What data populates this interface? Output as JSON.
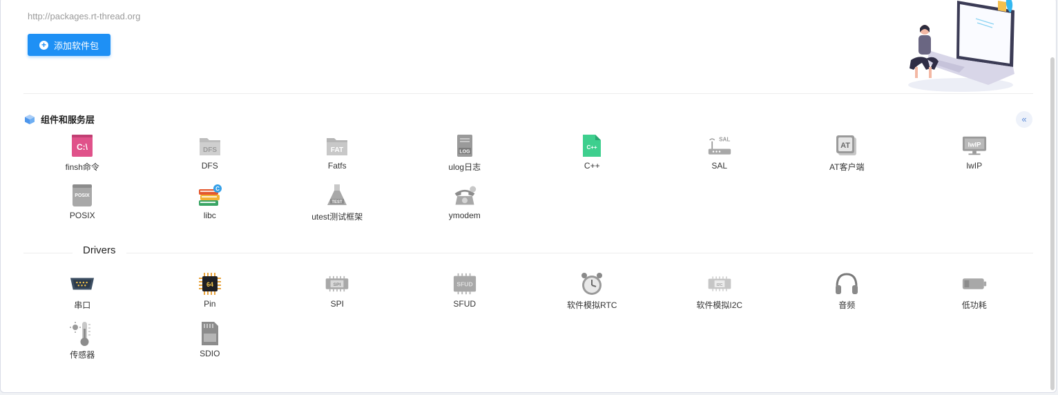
{
  "header": {
    "url": "http://packages.rt-thread.org",
    "add_button_label": "添加软件包"
  },
  "components": {
    "title": "组件和服务层",
    "collapse_glyph": "«",
    "items": [
      {
        "label": "finsh命令",
        "icon": "terminal-icon"
      },
      {
        "label": "DFS",
        "icon": "dfs-folder-icon"
      },
      {
        "label": "Fatfs",
        "icon": "fat-folder-icon"
      },
      {
        "label": "ulog日志",
        "icon": "log-file-icon"
      },
      {
        "label": "C++",
        "icon": "cpp-file-icon"
      },
      {
        "label": "SAL",
        "icon": "router-icon"
      },
      {
        "label": "AT客户端",
        "icon": "at-client-icon"
      },
      {
        "label": "lwIP",
        "icon": "lwip-monitor-icon"
      },
      {
        "label": "POSIX",
        "icon": "posix-box-icon"
      },
      {
        "label": "libc",
        "icon": "books-icon"
      },
      {
        "label": "utest测试框架",
        "icon": "test-flask-icon"
      },
      {
        "label": "ymodem",
        "icon": "telephone-icon"
      }
    ]
  },
  "drivers": {
    "title": "Drivers",
    "items": [
      {
        "label": "串口",
        "icon": "serial-port-icon"
      },
      {
        "label": "Pin",
        "icon": "chip-icon"
      },
      {
        "label": "SPI",
        "icon": "spi-chip-icon"
      },
      {
        "label": "SFUD",
        "icon": "sfud-chip-icon"
      },
      {
        "label": "软件模拟RTC",
        "icon": "alarm-clock-icon"
      },
      {
        "label": "软件模拟I2C",
        "icon": "i2c-chip-icon"
      },
      {
        "label": "音频",
        "icon": "headphones-icon"
      },
      {
        "label": "低功耗",
        "icon": "battery-icon"
      },
      {
        "label": "传感器",
        "icon": "thermometer-icon"
      },
      {
        "label": "SDIO",
        "icon": "sd-card-icon"
      }
    ]
  },
  "icon_text": {
    "terminal": "C:\\",
    "dfs": "DFS",
    "fat": "FAT",
    "log": "LOG",
    "cpp": "C++",
    "sal": "SAL",
    "at": "AT",
    "lwip": "lwIP",
    "posix": "POSIX",
    "libc_badge": "C",
    "test": "TEST",
    "chip": "64",
    "spi": "SPI",
    "sfud": "SFUD",
    "i2c": "I2C"
  },
  "colors": {
    "primary": "#1e90f5",
    "terminal_pink": "#e0528a",
    "cpp_green": "#3ecf8e",
    "icon_gray": "#b5b5b5"
  }
}
